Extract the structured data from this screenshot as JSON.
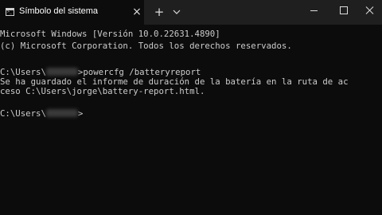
{
  "tab": {
    "title": "Símbolo del sistema",
    "icon": "command-prompt-icon",
    "prompt_glyph": ">_"
  },
  "tab_controls": {
    "close_glyph": "×",
    "new_tab_glyph": "+",
    "dropdown_icon": "chevron-down-icon"
  },
  "window_controls": {
    "minimize_icon": "minimize-icon",
    "maximize_icon": "maximize-icon",
    "close_icon": "close-icon"
  },
  "terminal": {
    "line1": "Microsoft Windows [Versión 10.0.22631.4890]",
    "line2": "(c) Microsoft Corporation. Todos los derechos reservados.",
    "prompt1_prefix": "C:\\Users\\",
    "prompt1_command": ">powercfg /batteryreport",
    "output1": "Se ha guardado el informe de duración de la batería en la ruta de ac",
    "output2": "ceso C:\\Users\\jorge\\battery-report.html.",
    "prompt2_prefix": "C:\\Users\\",
    "prompt2_suffix": ">"
  },
  "colors": {
    "background": "#0c0c0c",
    "titlebar": "#1f1f1f",
    "text": "#cccccc"
  }
}
